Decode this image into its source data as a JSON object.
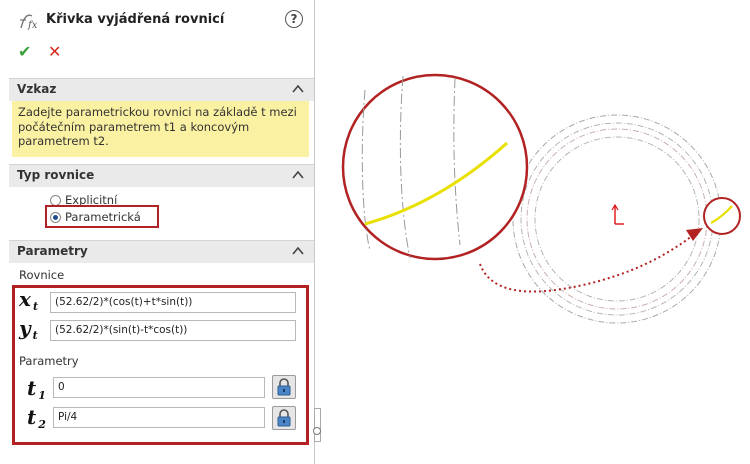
{
  "panel": {
    "title": "Křivka vyjádřená rovnicí",
    "help_symbol": "?",
    "ok_symbol": "✔",
    "cancel_symbol": "✕",
    "icons": {
      "title": "fx-icon",
      "help": "help-icon",
      "ok": "checkmark-icon",
      "cancel": "close-icon",
      "collapse": "chevron-up-icon",
      "lock": "lock-icon"
    }
  },
  "message": {
    "header": "Vzkaz",
    "lines": [
      "Zadejte parametrickou rovnici na základě t mezi",
      "počátečním parametrem t1 a koncovým",
      "parametrem t2."
    ]
  },
  "equation_type": {
    "header": "Typ rovnice",
    "options": [
      "Explicitní",
      "Parametrická"
    ],
    "selected": "Parametrická"
  },
  "parameters": {
    "header": "Parametry",
    "equations_label": "Rovnice",
    "x_label": "x",
    "x_sub": "t",
    "x_value": "(52.62/2)*(cos(t)+t*sin(t))",
    "y_label": "y",
    "y_sub": "t",
    "y_value": "(52.62/2)*(sin(t)-t*cos(t))",
    "params_label": "Parametry",
    "t1_label": "t",
    "t1_sub": "1",
    "t1_value": "0",
    "t2_label": "t",
    "t2_sub": "2",
    "t2_value": "Pi/4"
  },
  "colors": {
    "highlight": "#b22222",
    "message_bg": "#fbf1a3",
    "curve": "#e8e000",
    "ok": "#3aa13a",
    "cancel": "#d52b1e"
  }
}
